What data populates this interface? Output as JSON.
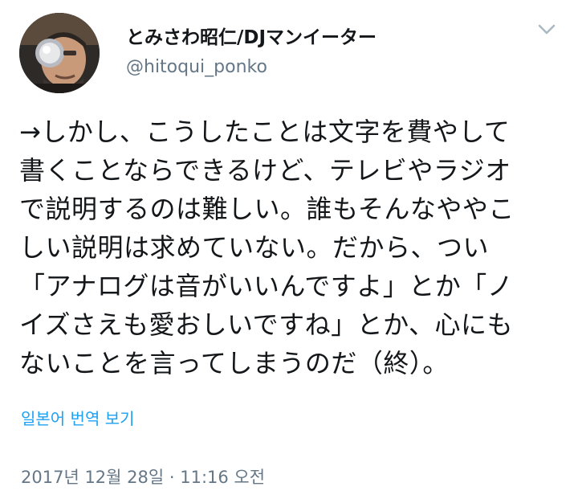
{
  "user": {
    "display_name": "とみさわ昭仁/DJマンイーター",
    "handle": "@hitoqui_ponko",
    "avatar_icon": "avatar-photo",
    "menu_icon": "chevron-down-icon"
  },
  "tweet": {
    "text": "→しかし、こうしたことは文字を費やして\n書くことならできるけど、テレビやラジオ\nで説明するのは難しい。誰もそんなややこ\nしい説明は求めていない。だから、つい\n「アナログは音がいいんですよ」とか「ノ\nイズさえも愛おしいですね」とか、心にも\nないことを言ってしまうのだ（終）。",
    "translate_label": "일본어 번역 보기",
    "timestamp": "2017년 12월 28일 · 11:16 오전"
  },
  "colors": {
    "text": "#14171a",
    "secondary": "#657786",
    "link": "#1da1f2"
  }
}
